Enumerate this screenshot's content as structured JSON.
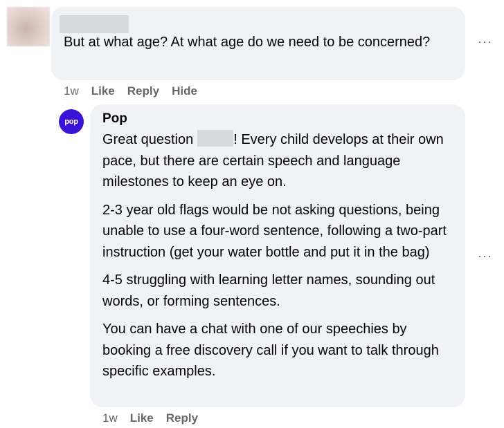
{
  "comment1": {
    "text": "But at what age? At what age do we need to be concerned?",
    "more": "···",
    "time": "1w",
    "like": "Like",
    "reply": "Reply",
    "hide": "Hide"
  },
  "comment2": {
    "avatar_label": "pop",
    "author": "Pop",
    "p1_before": "Great question",
    "p1_after": "! Every child develops at their own pace, but there are certain speech and language milestones to keep an eye on.",
    "p2": "2-3 year old flags would be not asking questions, being unable to use a four-word sentence, following a two-part instruction (get your water bottle and put it in the bag)",
    "p3": "4-5 struggling with learning letter names, sounding out words, or forming sentences.",
    "p4": "You can have a chat with one of our speechies by booking a free discovery call if you want to talk through specific examples.",
    "more": "···",
    "time": "1w",
    "like": "Like",
    "reply": "Reply"
  }
}
